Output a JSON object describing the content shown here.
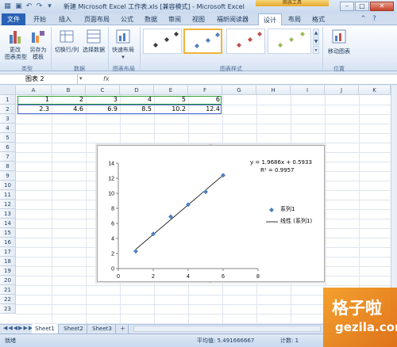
{
  "window": {
    "title": "新建 Microsoft Excel 工作表.xls [兼容模式] - Microsoft Excel",
    "context_tab_group": "图表工具",
    "buttons": {
      "minimize": "–",
      "maximize": "□",
      "close": "✕"
    }
  },
  "tabs": [
    {
      "label": "文件"
    },
    {
      "label": "开始"
    },
    {
      "label": "插入"
    },
    {
      "label": "页面布局"
    },
    {
      "label": "公式"
    },
    {
      "label": "数据"
    },
    {
      "label": "审阅"
    },
    {
      "label": "视图"
    },
    {
      "label": "福昕阅读器"
    },
    {
      "label": "设计"
    },
    {
      "label": "布局"
    },
    {
      "label": "格式"
    }
  ],
  "ribbon": {
    "change_chart_type": "更改\n图表类型",
    "save_as_template": "另存为\n模板",
    "group_type": "类型",
    "switch_row_col": "切换行/列",
    "select_data": "选择数据",
    "group_data": "数据",
    "quick_layout": "快速布局",
    "group_layout": "图表布局",
    "group_styles": "图表样式",
    "move_chart": "移动图表",
    "group_location": "位置"
  },
  "formula_bar": {
    "name_box": "图表 2",
    "fx": "fx"
  },
  "grid": {
    "columns": [
      "A",
      "B",
      "C",
      "D",
      "E",
      "F",
      "G",
      "H",
      "I",
      "J",
      "K"
    ],
    "rows": [
      "1",
      "2",
      "3",
      "4",
      "5",
      "6",
      "7",
      "8",
      "9",
      "10",
      "11",
      "12",
      "13",
      "14",
      "15",
      "16",
      "17",
      "18",
      "19",
      "20",
      "21",
      "22",
      "23"
    ],
    "row1": [
      "1",
      "2",
      "3",
      "4",
      "5",
      "6"
    ],
    "row2": [
      "2.3",
      "4.6",
      "6.9",
      "8.5",
      "10.2",
      "12.4"
    ]
  },
  "chart_data": {
    "type": "scatter",
    "x": [
      1,
      2,
      3,
      4,
      5,
      6
    ],
    "series": [
      {
        "name": "系列1",
        "values": [
          2.3,
          4.6,
          6.9,
          8.5,
          10.2,
          12.4
        ],
        "color": "#4f81bd"
      }
    ],
    "trendline": {
      "name": "线性 (系列1)",
      "slope": 1.9686,
      "intercept": 0.5933,
      "color": "#000000"
    },
    "equation": "y = 1.9686x + 0.5933",
    "r_squared": "R² = 0.9957",
    "x_ticks": [
      "0",
      "2",
      "4",
      "6",
      "8"
    ],
    "y_ticks": [
      "0",
      "2",
      "4",
      "6",
      "8",
      "10",
      "12",
      "14"
    ],
    "xlim": [
      0,
      8
    ],
    "ylim": [
      0,
      14
    ],
    "legend_position": "right",
    "grid": false
  },
  "sheets": [
    "Sheet1",
    "Sheet2",
    "Sheet3"
  ],
  "status": {
    "ready": "就绪",
    "average": "平均值: 5.491666667",
    "count": "计数: 1"
  },
  "watermark": {
    "main": "格子啦",
    "sub": "gezila.com"
  }
}
